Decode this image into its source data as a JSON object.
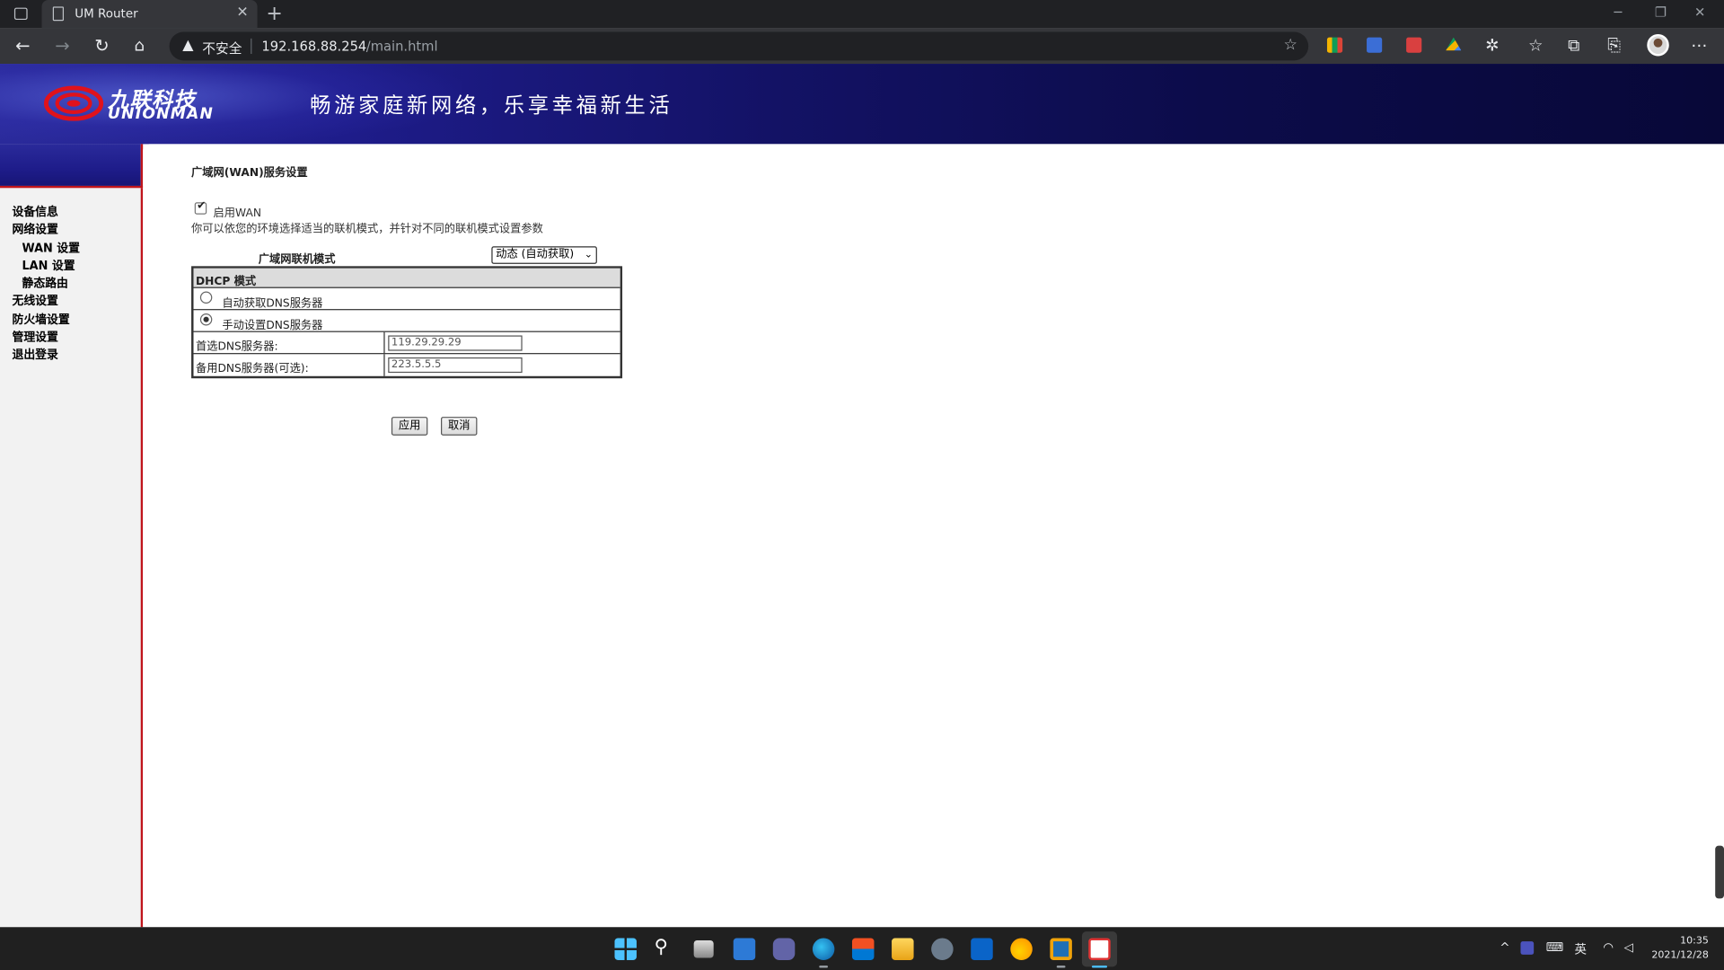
{
  "browser": {
    "tab_title": "UM Router",
    "new_tab": "+",
    "security_label": "不安全",
    "url_host": "192.168.88.254",
    "url_path": "/main.html"
  },
  "router": {
    "brand_cn": "九联科技",
    "brand_en": "UNIONMAN",
    "slogan": "畅游家庭新网络，乐享幸福新生活",
    "sidebar": {
      "items": [
        {
          "label": "设备信息",
          "sub": false
        },
        {
          "label": "网络设置",
          "sub": false
        },
        {
          "label": "WAN 设置",
          "sub": true
        },
        {
          "label": "LAN 设置",
          "sub": true
        },
        {
          "label": "静态路由",
          "sub": true
        },
        {
          "label": "无线设置",
          "sub": false
        },
        {
          "label": "防火墙设置",
          "sub": false
        },
        {
          "label": "管理设置",
          "sub": false
        },
        {
          "label": "退出登录",
          "sub": false
        }
      ]
    },
    "content": {
      "title": "广域网(WAN)服务设置",
      "enable_wan_label": "启用WAN",
      "enable_wan_checked": true,
      "hint": "你可以依您的环境选择适当的联机模式，并针对不同的联机模式设置参数",
      "mode_label": "广域网联机模式",
      "mode_value": "动态 (自动获取)",
      "dhcp": {
        "header": "DHCP 模式",
        "auto_dns_label": "自动获取DNS服务器",
        "manual_dns_label": "手动设置DNS服务器",
        "selected": "manual",
        "primary_dns_label": "首选DNS服务器:",
        "primary_dns_value": "119.29.29.29",
        "secondary_dns_label": "备用DNS服务器(可选):",
        "secondary_dns_value": "223.5.5.5"
      },
      "apply_label": "应用",
      "cancel_label": "取消"
    }
  },
  "taskbar": {
    "time": "10:35",
    "date": "2021/12/28",
    "ime": "英"
  },
  "colors": {
    "banner_dark": "#0c0c4a",
    "banner_light": "#2a2a9a",
    "accent_red": "#c0151c",
    "sidebar_bg": "#f2f2f2"
  }
}
